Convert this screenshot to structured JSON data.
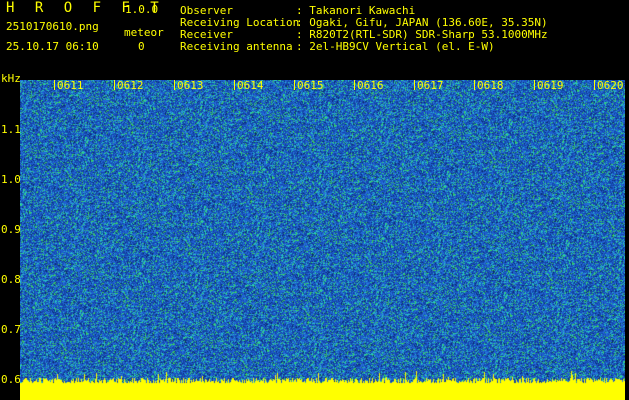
{
  "app": {
    "name": "H R O F F T",
    "version": "1.0.0"
  },
  "file": {
    "name": "2510170610.png",
    "datetime": "25.10.17 06:10"
  },
  "meteor": {
    "label": "meteor",
    "count": "0"
  },
  "info": [
    {
      "key": "Observer",
      "value": ": Takanori Kawachi"
    },
    {
      "key": "Receiving Location",
      "value": ": Ogaki, Gifu, JAPAN (136.60E, 35.35N)"
    },
    {
      "key": "Receiver",
      "value": ": R820T2(RTL-SDR) SDR-Sharp 53.1000MHz"
    },
    {
      "key": "Receiving antenna",
      "value": ": 2el-HB9CV Vertical (el. E-W)"
    }
  ],
  "axis": {
    "unit": "kHz",
    "y_labels": [
      "1.1",
      "1.0",
      "0.9",
      "0.8",
      "0.7",
      "0.6"
    ],
    "x_labels": [
      "0611",
      "0612",
      "0613",
      "0614",
      "0615",
      "0616",
      "0617",
      "0618",
      "0619",
      "0620"
    ]
  },
  "colors": {
    "text": "#ffff00",
    "background": "#000000",
    "noise_dark": "#0a2a6e",
    "noise_blue": "#1e5fd0",
    "noise_cyan": "#28c8c0",
    "noise_green": "#3ad05a"
  }
}
